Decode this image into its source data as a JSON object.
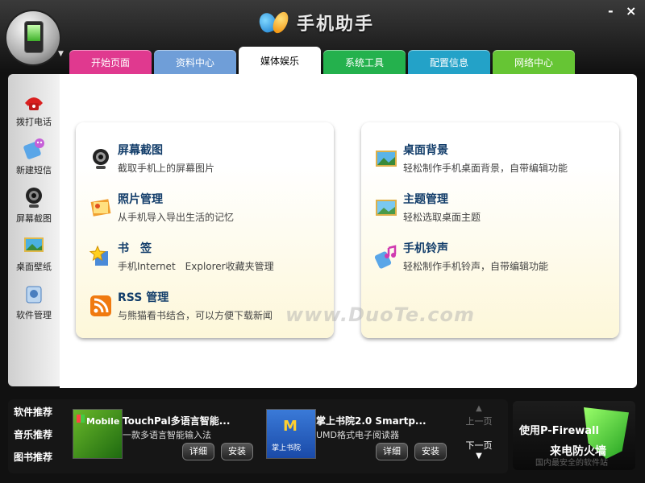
{
  "app": {
    "title": "手机助手"
  },
  "window": {
    "minimize": "-",
    "close": "×"
  },
  "colors": {
    "tab_start": "#e0398f",
    "tab_data": "#6f9ed8",
    "tab_system": "#24b14d",
    "tab_config": "#23a2c8",
    "tab_network": "#66c534"
  },
  "tabs": [
    {
      "label": "开始页面",
      "active": false
    },
    {
      "label": "资料中心",
      "active": false
    },
    {
      "label": "媒体娱乐",
      "active": true
    },
    {
      "label": "系统工具",
      "active": false
    },
    {
      "label": "配置信息",
      "active": false
    },
    {
      "label": "网络中心",
      "active": false
    }
  ],
  "sidebar": {
    "items": [
      {
        "label": "拨打电话",
        "icon": "phone-call-icon"
      },
      {
        "label": "新建短信",
        "icon": "sms-icon"
      },
      {
        "label": "屏幕截图",
        "icon": "webcam-icon"
      },
      {
        "label": "桌面壁纸",
        "icon": "wallpaper-icon"
      },
      {
        "label": "软件管理",
        "icon": "software-icon"
      }
    ]
  },
  "left_panel": {
    "items": [
      {
        "title": "屏幕截图",
        "desc": "截取手机上的屏幕图片",
        "icon": "webcam-icon"
      },
      {
        "title": "照片管理",
        "desc": "从手机导入导出生活的记忆",
        "icon": "photo-icon"
      },
      {
        "title": "书　签",
        "desc": "手机Internet　Explorer收藏夹管理",
        "icon": "bookmark-star-icon"
      },
      {
        "title": "RSS 管理",
        "desc": "与熊猫看书结合，可以方便下载新闻",
        "icon": "rss-icon"
      }
    ]
  },
  "right_panel": {
    "items": [
      {
        "title": "桌面背景",
        "desc": "轻松制作手机桌面背景，自带编辑功能",
        "icon": "desktop-bg-icon"
      },
      {
        "title": "主题管理",
        "desc": "轻松选取桌面主题",
        "icon": "theme-icon"
      },
      {
        "title": "手机铃声",
        "desc": "轻松制作手机铃声，自带编辑功能",
        "icon": "ringtone-icon"
      }
    ]
  },
  "watermark": "www.DuoTe.com",
  "bottom": {
    "tabs": [
      "软件推荐",
      "音乐推荐",
      "图书推荐"
    ],
    "apps": [
      {
        "name": "TouchPal多语言智能...",
        "desc": "一款多语言智能输入法",
        "thumb_text": "Mobile",
        "detail": "详细",
        "install": "安装"
      },
      {
        "name": "掌上书院2.0 Smartp...",
        "desc": "UMD格式电子阅读器",
        "thumb_text": "掌上书院",
        "detail": "详细",
        "install": "安装"
      }
    ],
    "pager": {
      "prev": "上一页",
      "next": "下一页"
    }
  },
  "ad": {
    "line1": "使用P-Firewall",
    "line2": "来电防火墙",
    "watermark": "国内最安全的软件站"
  }
}
